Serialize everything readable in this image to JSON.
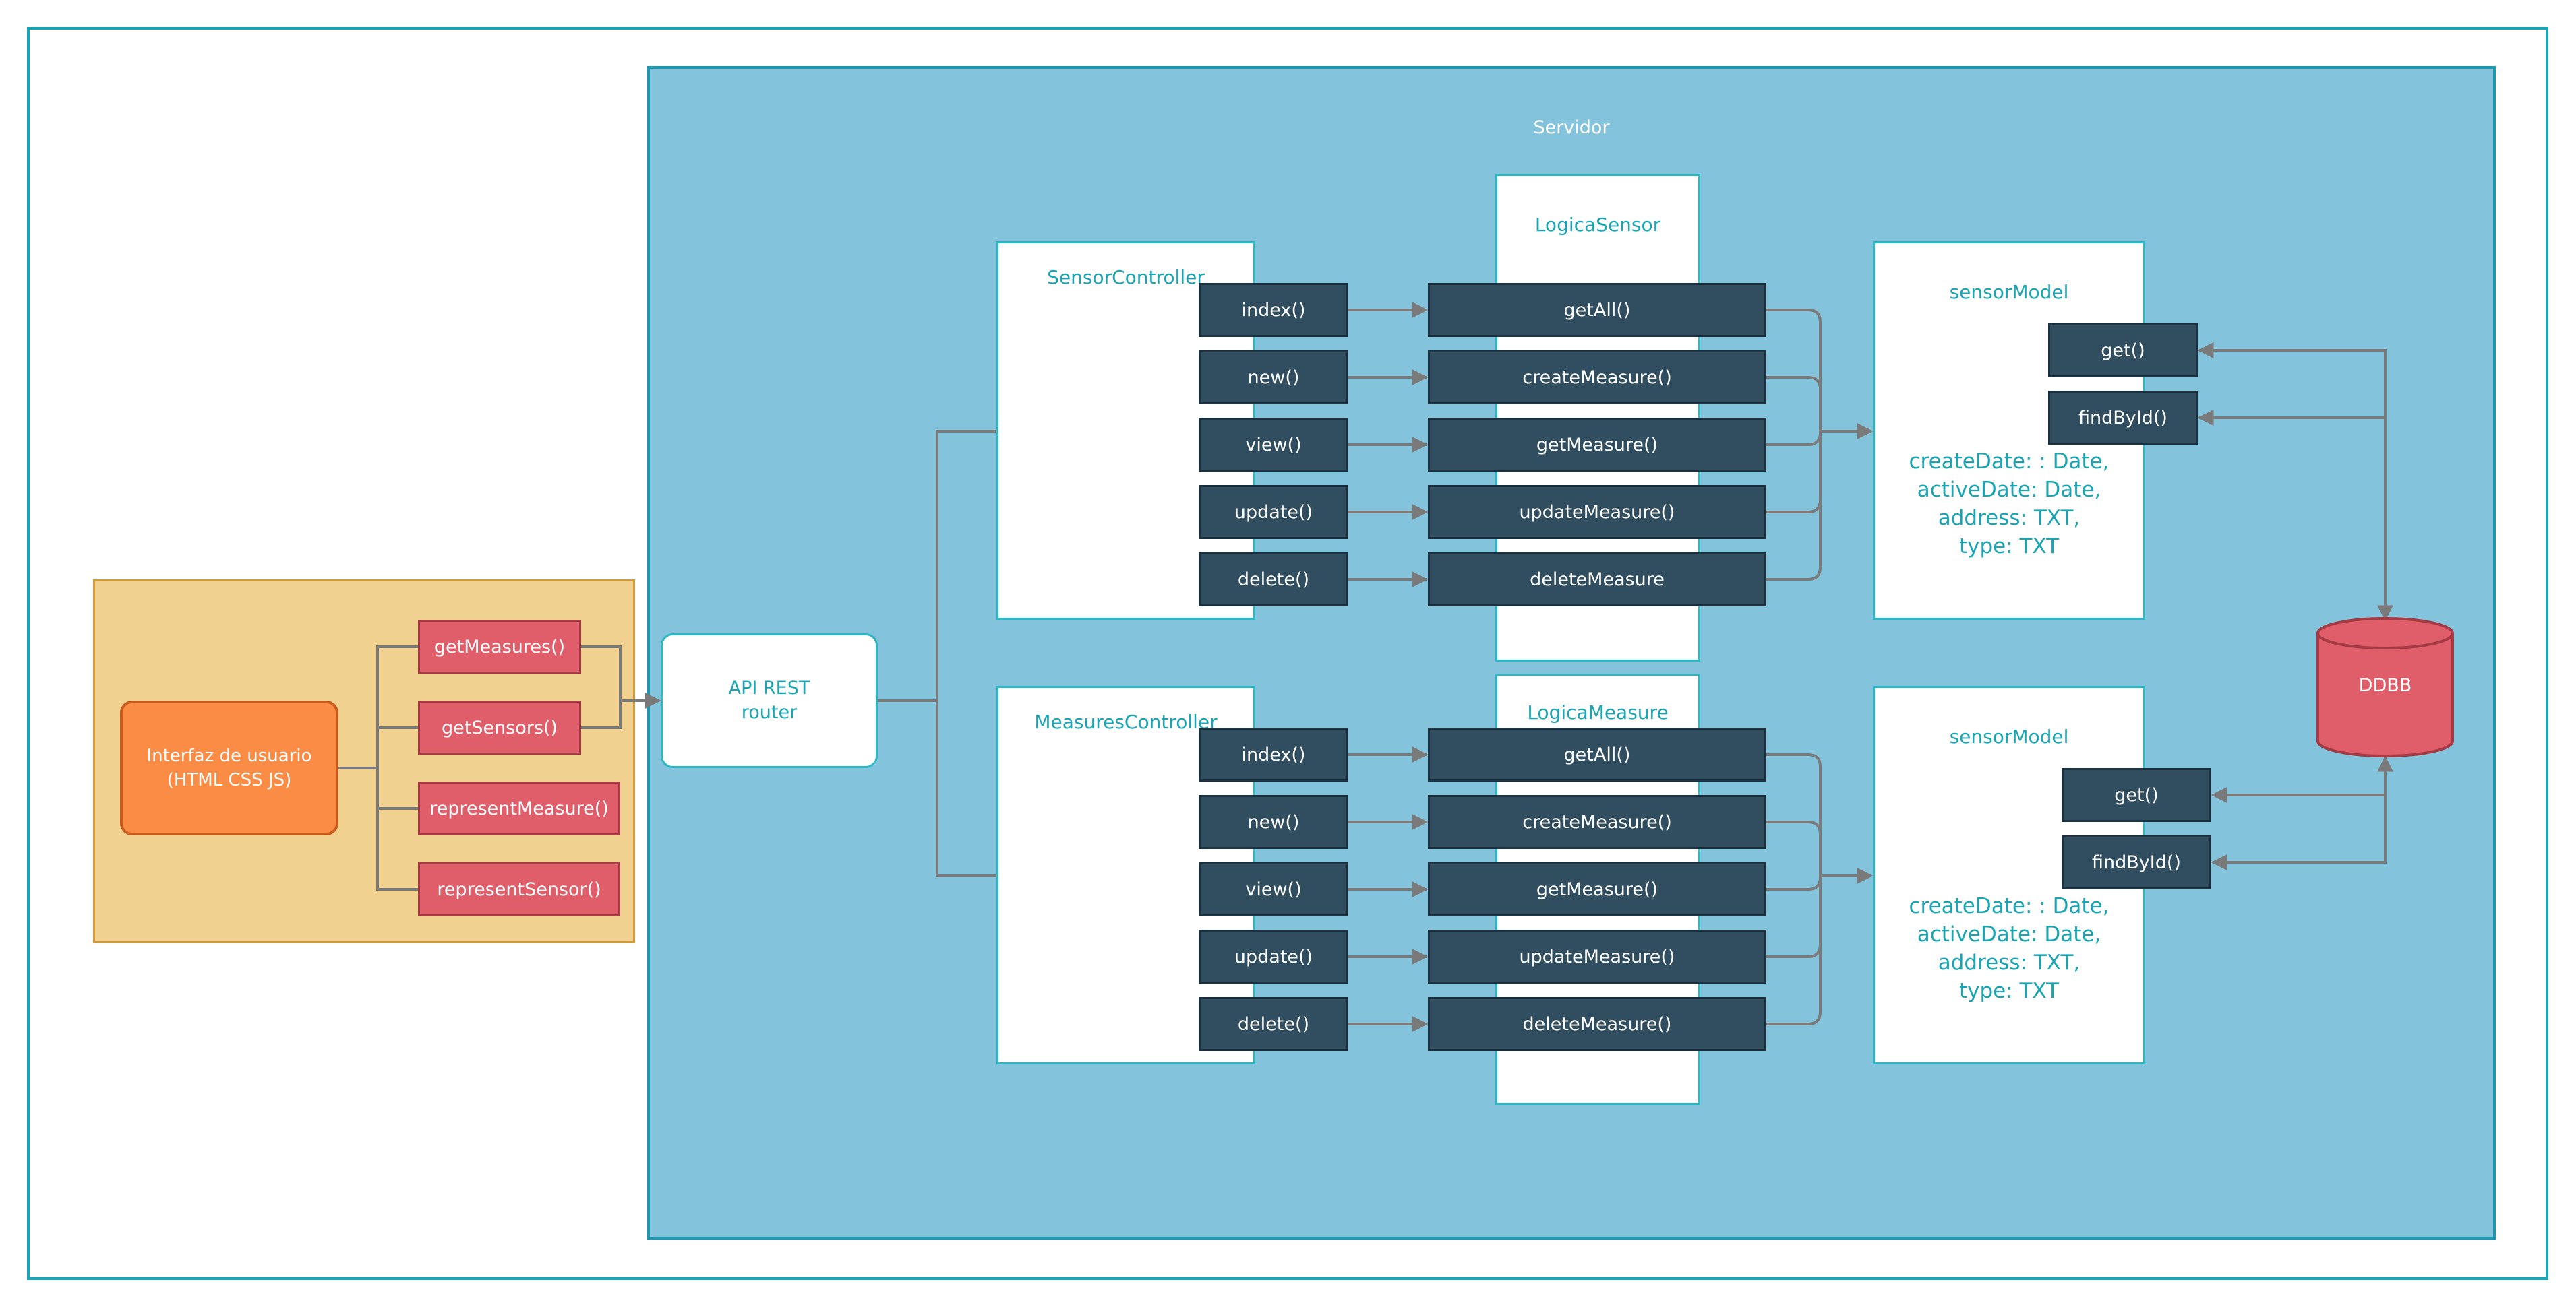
{
  "client": {
    "ui_line1": "Interfaz de usuario",
    "ui_line2": "(HTML CSS JS)",
    "methods": [
      "getMeasures()",
      "getSensors()",
      "representMeasure()",
      "representSensor()"
    ]
  },
  "server": {
    "title": "Servidor",
    "api_line1": "API REST",
    "api_line2": "router",
    "db": "DDBB"
  },
  "sensor_controller": {
    "title": "SensorController",
    "methods": [
      "index()",
      "new()",
      "view()",
      "update()",
      "delete()"
    ]
  },
  "measures_controller": {
    "title": "MeasuresController",
    "methods": [
      "index()",
      "new()",
      "view()",
      "update()",
      "delete()"
    ]
  },
  "logica_sensor": {
    "title": "LogicaSensor",
    "methods": [
      "getAll()",
      "createMeasure()",
      "getMeasure()",
      "updateMeasure()",
      "deleteMeasure"
    ]
  },
  "logica_measure": {
    "title": "LogicaMeasure",
    "methods": [
      "getAll()",
      "createMeasure()",
      "getMeasure()",
      "updateMeasure()",
      "deleteMeasure()"
    ]
  },
  "sensor_model_top": {
    "title": "sensorModel",
    "methods": [
      "get()",
      "findById()"
    ],
    "attributes": [
      "createDate: : Date,",
      "activeDate: Date,",
      "address: TXT,",
      "type: TXT"
    ]
  },
  "sensor_model_bottom": {
    "title": "sensorModel",
    "methods": [
      "get()",
      "findById()"
    ],
    "attributes": [
      "createDate: : Date,",
      "activeDate: Date,",
      "address: TXT,",
      "type: TXT"
    ]
  },
  "colors": {
    "server_fill": "#84c3dc",
    "client_fill": "#f0d18f",
    "ui_fill": "#fb8c45",
    "method_red": "#e05e6a",
    "method_dark": "#304e60",
    "accent_teal": "#1aa5b4",
    "connector": "#7a7a7a"
  }
}
